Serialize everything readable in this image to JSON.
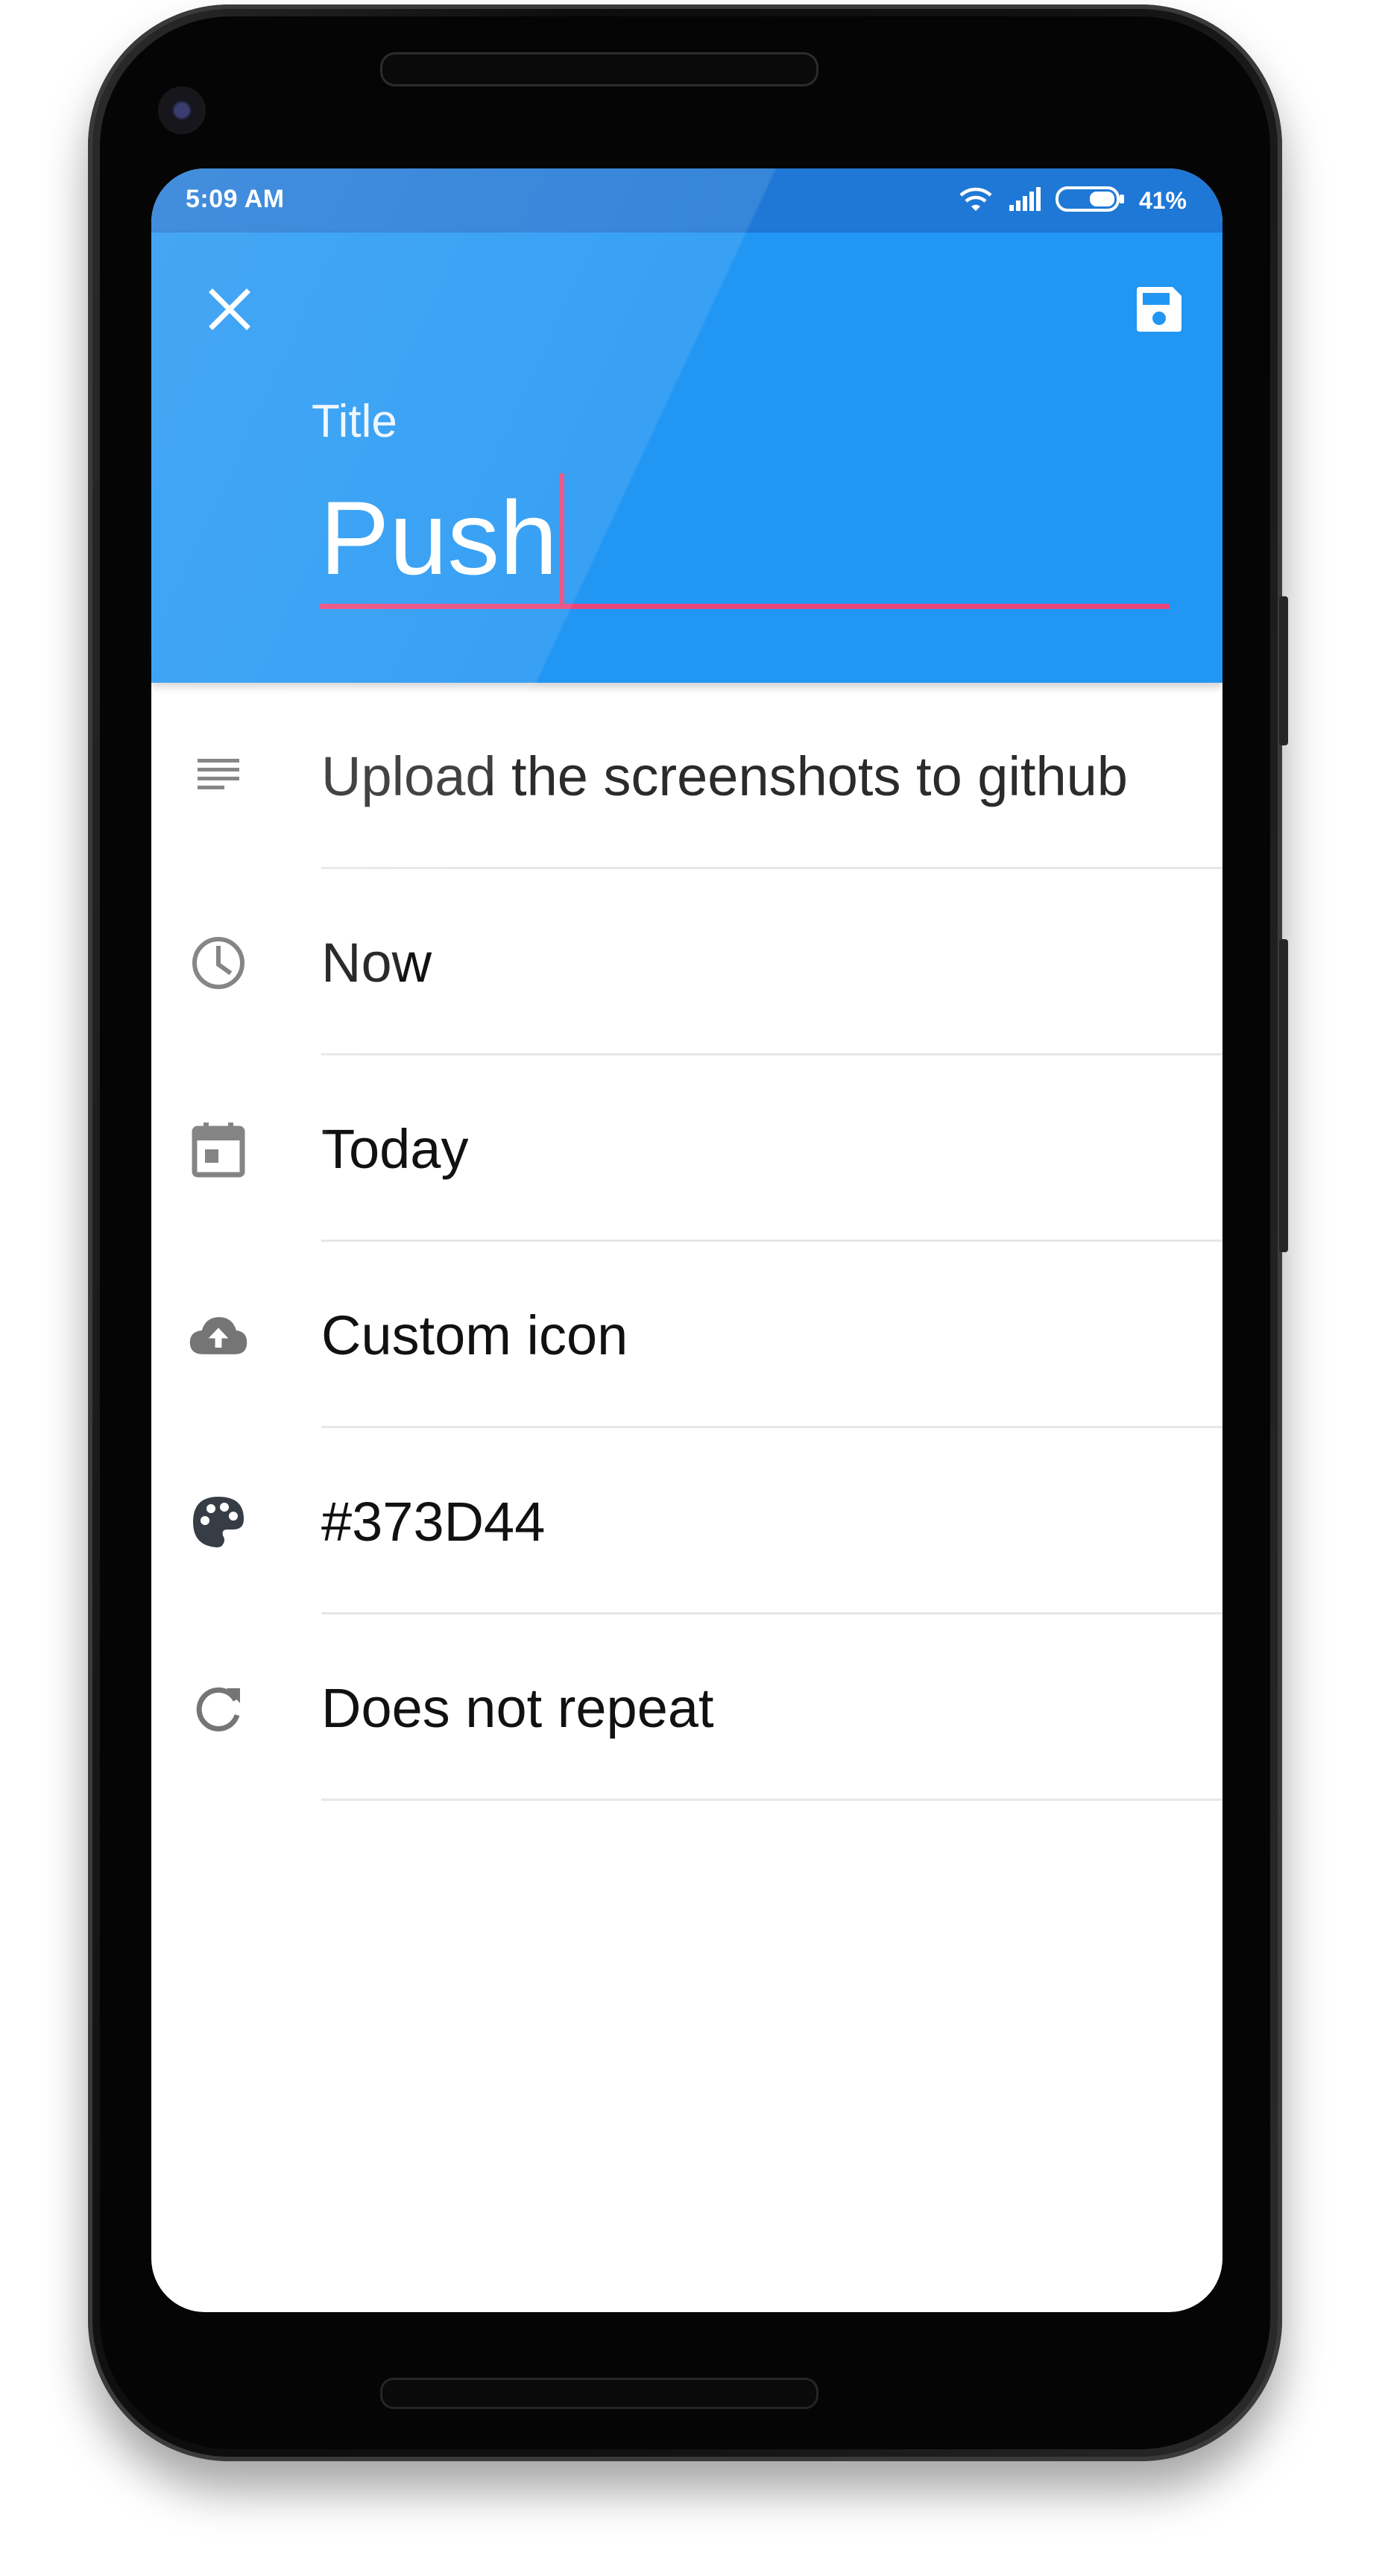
{
  "status_bar": {
    "time": "5:09 AM",
    "battery_percent": "41%"
  },
  "app_bar": {
    "title_label": "Title",
    "title_value": "Push",
    "close_icon": "close-icon",
    "save_icon": "save-icon"
  },
  "colors": {
    "primary": "#2196f3",
    "status_bar": "#1f78d6",
    "accent": "#e8457a",
    "icon_gray": "#757575"
  },
  "fields": [
    {
      "icon": "notes-icon",
      "text": "Upload the screenshots to github"
    },
    {
      "icon": "clock-icon",
      "text": "Now"
    },
    {
      "icon": "calendar-icon",
      "text": "Today"
    },
    {
      "icon": "cloud-upload-icon",
      "text": "Custom icon"
    },
    {
      "icon": "palette-icon",
      "text": "#373D44"
    },
    {
      "icon": "repeat-icon",
      "text": "Does not repeat"
    }
  ]
}
